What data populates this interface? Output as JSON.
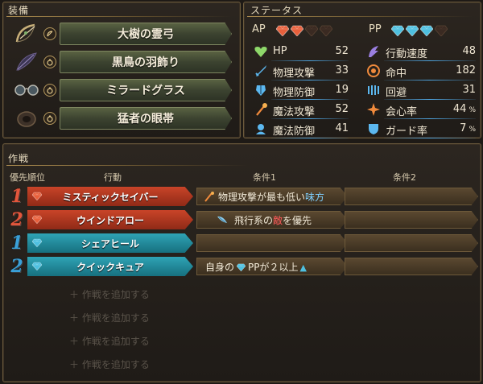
{
  "equipment": {
    "title": "装備",
    "items": [
      {
        "name": "大樹の霊弓",
        "slot_icon": "bow-slot-icon"
      },
      {
        "name": "黒鳥の羽飾り",
        "slot_icon": "ring-slot-icon"
      },
      {
        "name": "ミラードグラス",
        "slot_icon": "ring-slot-icon"
      },
      {
        "name": "猛者の眼帯",
        "slot_icon": "ring-slot-icon"
      }
    ]
  },
  "status": {
    "title": "ステータス",
    "ap": {
      "label": "AP",
      "filled": 2,
      "total": 4,
      "color": "#e8603c"
    },
    "pp": {
      "label": "PP",
      "filled": 3,
      "total": 4,
      "color": "#4ec0e0"
    },
    "stats_left": [
      {
        "name": "HP",
        "value": "52",
        "icon": "heart-icon"
      },
      {
        "name": "物理攻撃",
        "value": "33",
        "icon": "sword-icon"
      },
      {
        "name": "物理防御",
        "value": "19",
        "icon": "armor-icon"
      },
      {
        "name": "魔法攻撃",
        "value": "52",
        "icon": "staff-icon"
      },
      {
        "name": "魔法防御",
        "value": "41",
        "icon": "magic-shield-icon"
      }
    ],
    "stats_right": [
      {
        "name": "行動速度",
        "value": "48",
        "unit": "",
        "icon": "speed-icon"
      },
      {
        "name": "命中",
        "value": "182",
        "unit": "",
        "icon": "target-icon"
      },
      {
        "name": "回避",
        "value": "31",
        "unit": "",
        "icon": "evade-icon"
      },
      {
        "name": "会心率",
        "value": "44",
        "unit": "%",
        "icon": "critical-icon"
      },
      {
        "name": "ガード率",
        "value": "7",
        "unit": "%",
        "icon": "guard-icon"
      }
    ]
  },
  "strategy": {
    "title": "作戦",
    "headers": {
      "priority": "優先順位",
      "action": "行動",
      "cond1": "条件1",
      "cond2": "条件2"
    },
    "rows": [
      {
        "priority": "1",
        "type": "red",
        "action": "ミスティックセイバー",
        "cond1_pre": "物理攻撃が最も低い",
        "cond1_hl": "味方",
        "cond1_post": "",
        "cond1_icon": "staff-icon"
      },
      {
        "priority": "2",
        "type": "red",
        "action": "ウインドアロー",
        "cond1_pre": "飛行系の",
        "cond1_hl": "敵",
        "cond1_post": "を優先",
        "cond1_icon": "wing-icon"
      },
      {
        "priority": "1",
        "type": "blue",
        "action": "シェアヒール",
        "cond1_pre": "",
        "cond1_hl": "",
        "cond1_post": "",
        "cond1_icon": ""
      },
      {
        "priority": "2",
        "type": "blue",
        "action": "クイックキュア",
        "cond1_pre": "自身の",
        "cond1_hl": "",
        "cond1_post": "PPが２以上",
        "cond1_icon": ""
      }
    ],
    "add_label": "＋ 作戦を追加する",
    "add_count": 4
  },
  "colors": {
    "ap_gem": "#e8603c",
    "pp_gem": "#4ec0e0",
    "enemy": "#ff5a5a",
    "ally": "#7fd0ff",
    "up_arrow": "#4ec0e0"
  }
}
